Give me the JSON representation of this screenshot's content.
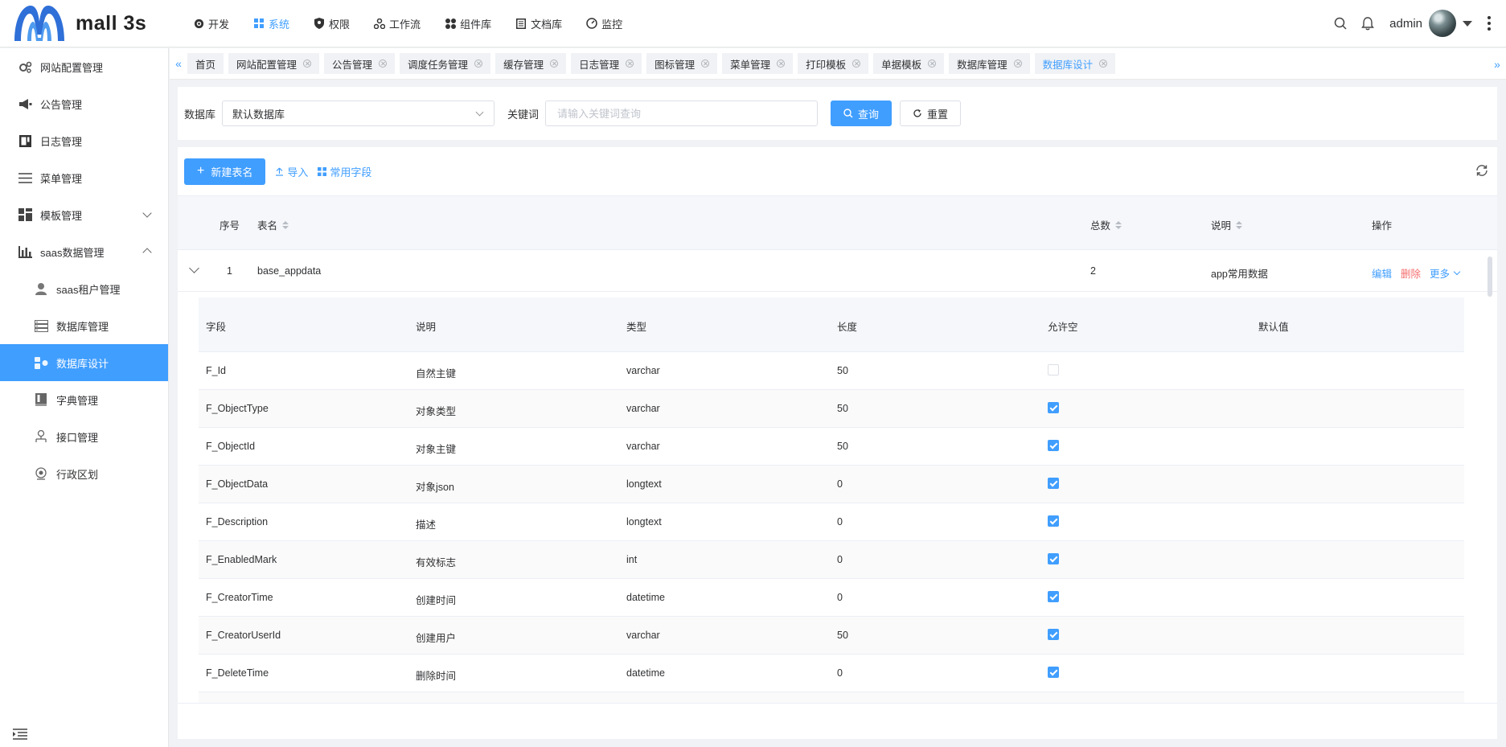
{
  "brand": {
    "name": "mall 3s"
  },
  "topnav": [
    {
      "label": "开发",
      "icon": "code-icon",
      "active": false
    },
    {
      "label": "系统",
      "icon": "grid-icon",
      "active": true
    },
    {
      "label": "权限",
      "icon": "shield-icon",
      "active": false
    },
    {
      "label": "工作流",
      "icon": "workflow-icon",
      "active": false
    },
    {
      "label": "组件库",
      "icon": "components-icon",
      "active": false
    },
    {
      "label": "文档库",
      "icon": "document-icon",
      "active": false
    },
    {
      "label": "监控",
      "icon": "gauge-icon",
      "active": false
    }
  ],
  "user": {
    "name": "admin"
  },
  "sidebar": {
    "items": [
      {
        "label": "网站配置管理",
        "icon": "gears-icon"
      },
      {
        "label": "公告管理",
        "icon": "megaphone-icon"
      },
      {
        "label": "日志管理",
        "icon": "log-book-icon"
      },
      {
        "label": "菜单管理",
        "icon": "menu-lines-icon"
      },
      {
        "label": "模板管理",
        "icon": "template-icon",
        "expandable": true
      },
      {
        "label": "saas数据管理",
        "icon": "bar-chart-icon",
        "expanded": true
      },
      {
        "label": "saas租户管理",
        "icon": "tenant-icon",
        "sub": true
      },
      {
        "label": "数据库管理",
        "icon": "database-icon",
        "sub": true
      },
      {
        "label": "数据库设计",
        "icon": "db-design-icon",
        "sub": true,
        "active": true
      },
      {
        "label": "字典管理",
        "icon": "dictionary-icon",
        "sub": true
      },
      {
        "label": "接口管理",
        "icon": "api-icon",
        "sub": true
      },
      {
        "label": "行政区划",
        "icon": "region-icon",
        "sub": true
      }
    ]
  },
  "tabs": [
    {
      "label": "首页",
      "closable": false
    },
    {
      "label": "网站配置管理",
      "closable": true
    },
    {
      "label": "公告管理",
      "closable": true
    },
    {
      "label": "调度任务管理",
      "closable": true
    },
    {
      "label": "缓存管理",
      "closable": true
    },
    {
      "label": "日志管理",
      "closable": true
    },
    {
      "label": "图标管理",
      "closable": true
    },
    {
      "label": "菜单管理",
      "closable": true
    },
    {
      "label": "打印模板",
      "closable": true
    },
    {
      "label": "单据模板",
      "closable": true
    },
    {
      "label": "数据库管理",
      "closable": true
    },
    {
      "label": "数据库设计",
      "closable": true,
      "active": true
    }
  ],
  "search": {
    "db_label": "数据库",
    "db_value": "默认数据库",
    "keyword_label": "关键词",
    "keyword_placeholder": "请输入关键词查询",
    "keyword_value": "",
    "query_label": "查询",
    "reset_label": "重置"
  },
  "toolbar": {
    "new_label": "新建表名",
    "import_label": "导入",
    "common_fields_label": "常用字段"
  },
  "table": {
    "headers": {
      "index": "序号",
      "name": "表名",
      "total": "总数",
      "desc": "说明",
      "ops": "操作"
    },
    "rows": [
      {
        "index": "1",
        "name": "base_appdata",
        "total": "2",
        "desc": "app常用数据",
        "edit": "编辑",
        "delete": "删除",
        "more": "更多"
      }
    ]
  },
  "fields": {
    "headers": {
      "field": "字段",
      "desc": "说明",
      "type": "类型",
      "length": "长度",
      "nullable": "允许空",
      "default": "默认值"
    },
    "rows": [
      {
        "field": "F_Id",
        "desc": "自然主键",
        "type": "varchar",
        "length": "50",
        "nullable": false,
        "default": ""
      },
      {
        "field": "F_ObjectType",
        "desc": "对象类型",
        "type": "varchar",
        "length": "50",
        "nullable": true,
        "default": ""
      },
      {
        "field": "F_ObjectId",
        "desc": "对象主键",
        "type": "varchar",
        "length": "50",
        "nullable": true,
        "default": ""
      },
      {
        "field": "F_ObjectData",
        "desc": "对象json",
        "type": "longtext",
        "length": "0",
        "nullable": true,
        "default": ""
      },
      {
        "field": "F_Description",
        "desc": "描述",
        "type": "longtext",
        "length": "0",
        "nullable": true,
        "default": ""
      },
      {
        "field": "F_EnabledMark",
        "desc": "有效标志",
        "type": "int",
        "length": "0",
        "nullable": true,
        "default": ""
      },
      {
        "field": "F_CreatorTime",
        "desc": "创建时间",
        "type": "datetime",
        "length": "0",
        "nullable": true,
        "default": ""
      },
      {
        "field": "F_CreatorUserId",
        "desc": "创建用户",
        "type": "varchar",
        "length": "50",
        "nullable": true,
        "default": ""
      },
      {
        "field": "F_DeleteTime",
        "desc": "删除时间",
        "type": "datetime",
        "length": "0",
        "nullable": true,
        "default": ""
      }
    ]
  }
}
